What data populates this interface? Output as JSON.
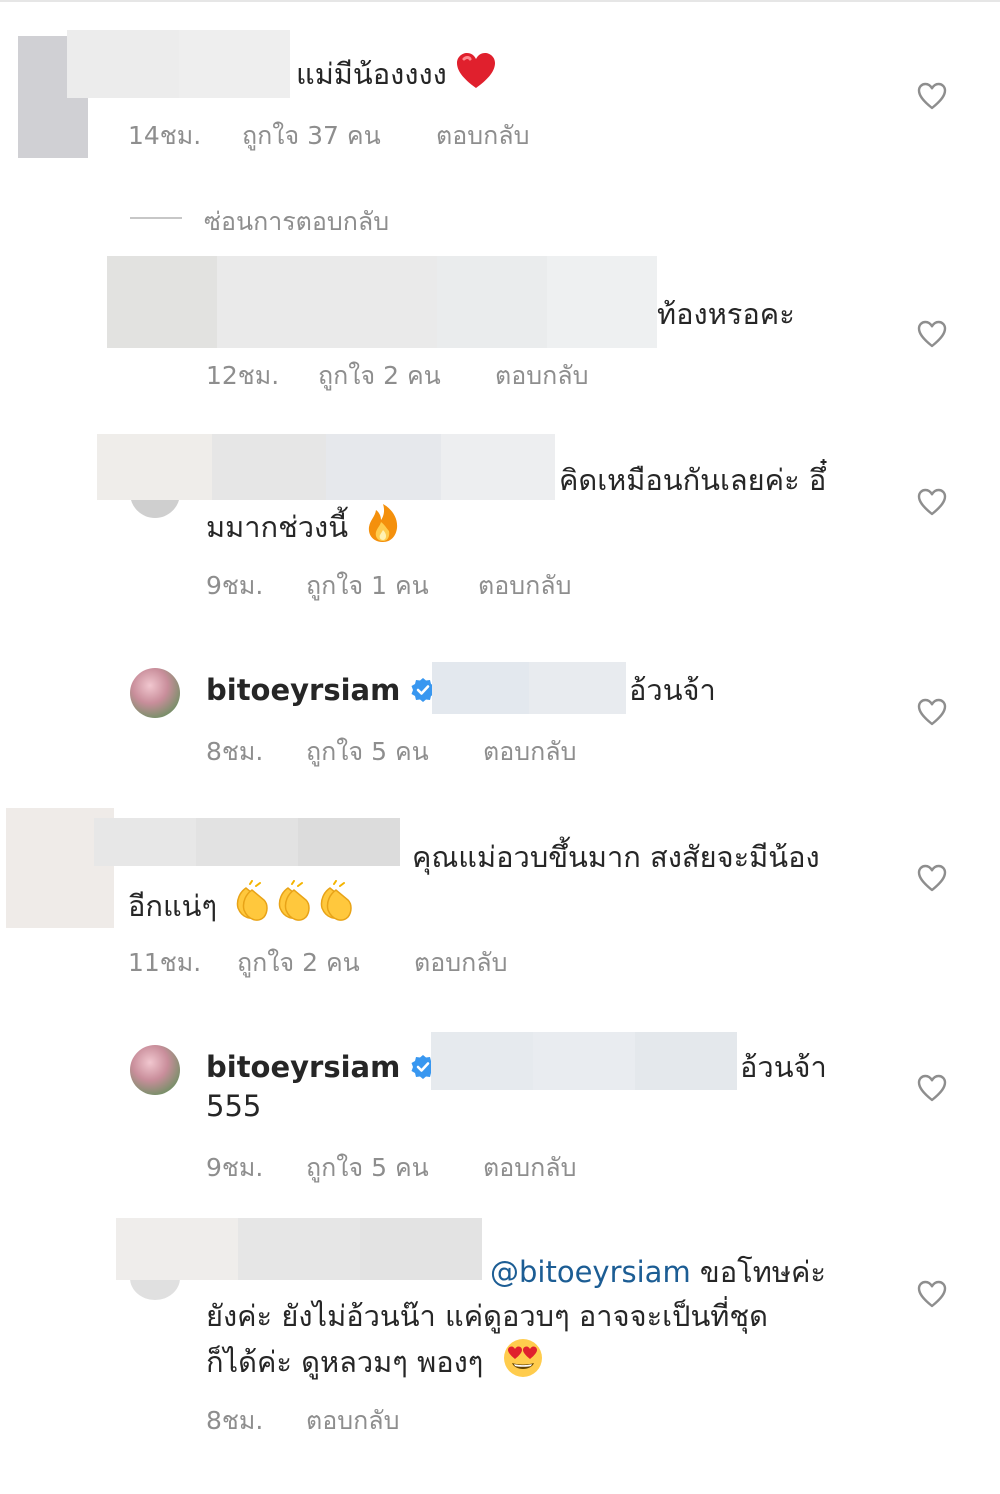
{
  "labels": {
    "like_prefix": "ถูกใจ",
    "like_suffix": "คน",
    "reply": "ตอบกลับ"
  },
  "hide_replies": "ซ่อนการตอบกลับ",
  "comments": [
    {
      "text": "แม่มีน้องงงง",
      "emoji": "heart",
      "time": "14ชม.",
      "likes": "37"
    },
    {
      "text": "ท้องหรอคะ",
      "time": "12ชม.",
      "likes": "2"
    },
    {
      "text_line1": "คิดเหมือนกันเลยค่ะ อึ๋",
      "text_line2": "มมากช่วงนี้",
      "emoji": "fire",
      "time": "9ชม.",
      "likes": "1"
    },
    {
      "username": "bitoeyrsiam",
      "text": "อ้วนจ้า",
      "time": "8ชม.",
      "likes": "5"
    },
    {
      "text_line1": "คุณแม่อวบขึ้นมาก สงสัยจะมีน้อง",
      "text_line2": "อีกแน่ๆ",
      "emoji": "clap x3",
      "time": "11ชม.",
      "likes": "2"
    },
    {
      "username": "bitoeyrsiam",
      "text": "อ้วนจ้า",
      "text_line2": "555",
      "time": "9ชม.",
      "likes": "5"
    },
    {
      "mention": "@bitoeyrsiam",
      "text_line1": "ขอโทษค่ะ",
      "text_line2": "ยังค่ะ ยังไม่อ้วนน๊า แค่ดูอวบๆ อาจจะเป็นที่ชุด",
      "text_line3": "ก็ได้ค่ะ ดูหลวมๆ พองๆ",
      "emoji": "heart-eyes",
      "time": "8ชม."
    }
  ],
  "colors": {
    "text": "#262626",
    "meta": "#8e8e8e",
    "mention": "#1c5d94",
    "verified": "#3897f0"
  }
}
